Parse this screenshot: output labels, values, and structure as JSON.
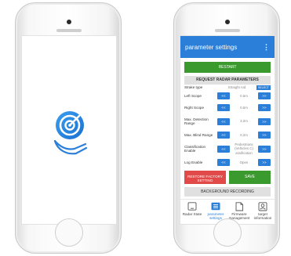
{
  "app_bar": {
    "title": "parameter settings",
    "menu_icon": "more-vertical-icon"
  },
  "buttons": {
    "restart": "RESTART",
    "request_params": "REQUEST RADAR PARAMETERS",
    "restore_factory": "RESTORE FACTORY SETTING",
    "save": "SAVE",
    "background_recording": "BACKGROUND RECORDING"
  },
  "strake": {
    "label": "Strake type",
    "value": "Straight rod",
    "chip": "SELECT"
  },
  "params": [
    {
      "label": "Left Scope",
      "dec": "<<",
      "value": "0.5m",
      "inc": ">>"
    },
    {
      "label": "Right Scope",
      "dec": "<<",
      "value": "0.5m",
      "inc": ">>"
    },
    {
      "label": "Max. Detection Range",
      "dec": "<<",
      "value": "3.2m",
      "inc": ">>"
    },
    {
      "label": "Max. Blind Range",
      "dec": "<<",
      "value": "0.2m",
      "inc": ">>"
    },
    {
      "label": "Classification Enable",
      "dec": "<<",
      "value": "Pedestrians (Vehicles C) assification",
      "inc": ">>"
    },
    {
      "label": "Log Enable",
      "dec": "<<",
      "value": "Open",
      "inc": ">>"
    }
  ],
  "nav": [
    {
      "label": "Radar State",
      "icon": "tablet-icon"
    },
    {
      "label": "parameter settings",
      "icon": "settings-list-icon"
    },
    {
      "label": "Firmware management",
      "icon": "document-icon"
    },
    {
      "label": "target information",
      "icon": "person-card-icon"
    }
  ],
  "colors": {
    "primary": "#2b7fd8",
    "success": "#3a9a2e",
    "danger": "#e24a4a",
    "neutral": "#e0e0e0"
  }
}
